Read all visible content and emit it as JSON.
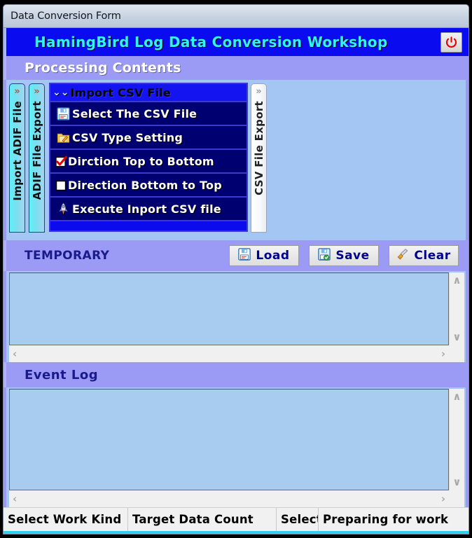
{
  "window": {
    "title": "Data Conversion Form"
  },
  "header": {
    "app_title": "HamingBird Log Data Conversion Workshop",
    "title_color": "#33f3fa",
    "bar_color": "#0b0bf0",
    "power_button": {
      "icon": "power-icon",
      "color": "#e00000"
    }
  },
  "processing": {
    "section_title": "Processing Contents",
    "left_tabs": [
      {
        "label": "Import ADIF File",
        "chevron": "»",
        "style": "cyan"
      },
      {
        "label": "ADIF File Export",
        "chevron": "»",
        "style": "cyan"
      }
    ],
    "right_tabs": [
      {
        "label": "CSV File Export",
        "chevron": "»",
        "style": "white"
      }
    ],
    "list": {
      "header": {
        "chevron": "⌄⌄",
        "label": "Import CSV File"
      },
      "items": [
        {
          "label": "Select The CSV File",
          "icon": "floppy-disk-icon",
          "type": "action"
        },
        {
          "label": "CSV Type Setting",
          "icon": "folder-edit-icon",
          "type": "action"
        },
        {
          "label": "Dirction Top to Bottom",
          "icon": "checkbox-checked-icon",
          "type": "checkbox",
          "checked": true
        },
        {
          "label": "Direction Bottom to Top",
          "icon": "checkbox-unchecked-icon",
          "type": "checkbox",
          "checked": false
        },
        {
          "label": "Execute Inport CSV file",
          "icon": "rocket-icon",
          "type": "action"
        }
      ]
    }
  },
  "temporary": {
    "title": "TEMPORARY",
    "buttons": [
      {
        "label": "Load",
        "icon": "floppy-load-icon"
      },
      {
        "label": "Save",
        "icon": "floppy-save-icon"
      },
      {
        "label": "Clear",
        "icon": "broom-icon"
      }
    ],
    "textarea": {
      "value": "",
      "placeholder": ""
    },
    "scroll": {
      "up": "∧",
      "down": "∨",
      "left": "‹",
      "right": "›"
    }
  },
  "event_log": {
    "title": "Event Log",
    "textarea": {
      "value": "",
      "placeholder": ""
    },
    "scroll": {
      "up": "∧",
      "down": "∨",
      "left": "‹",
      "right": "›"
    }
  },
  "statusbar": {
    "panels": [
      {
        "text": "Select Work Kind"
      },
      {
        "text": "Target Data Count"
      },
      {
        "text": "Select"
      },
      {
        "text": "Preparing for work"
      }
    ]
  }
}
